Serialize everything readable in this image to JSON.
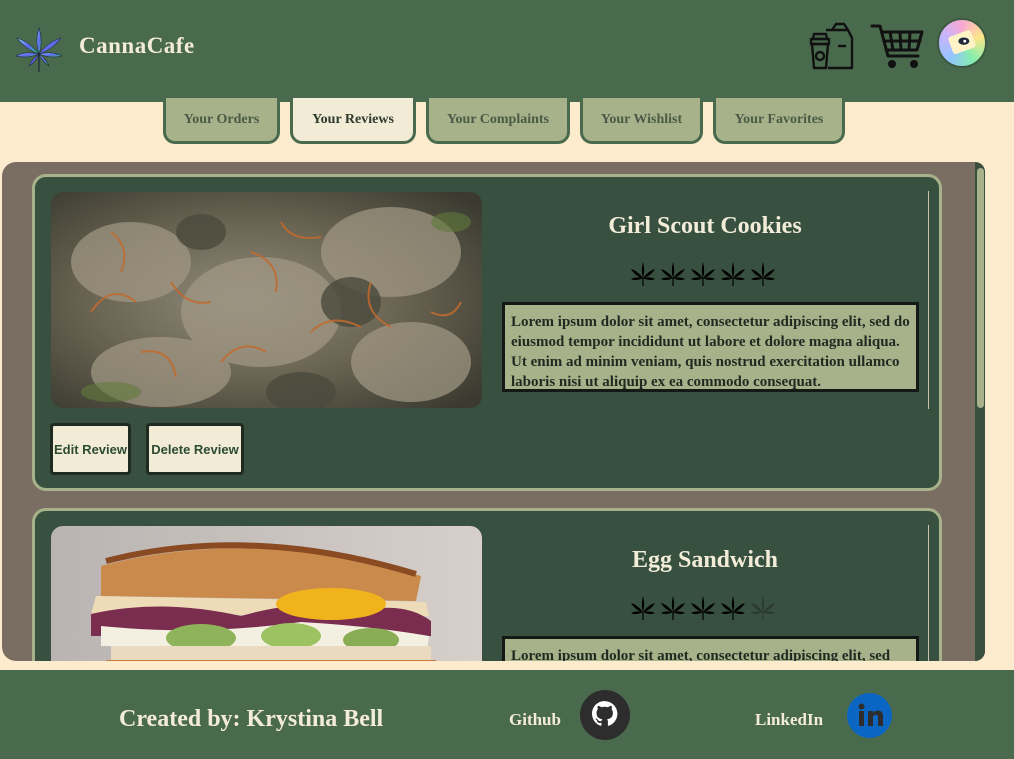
{
  "header": {
    "brand": "CannaCafe",
    "icons": [
      "cannabis-logo-icon",
      "coffee-bag-icon",
      "shopping-cart-icon",
      "avatar"
    ]
  },
  "tabs": [
    {
      "label": "Your Orders",
      "active": false
    },
    {
      "label": "Your Reviews",
      "active": true
    },
    {
      "label": "Your Complaints",
      "active": false
    },
    {
      "label": "Your Wishlist",
      "active": false
    },
    {
      "label": "Your Favorites",
      "active": false
    }
  ],
  "reviews": [
    {
      "title": "Girl Scout Cookies",
      "rating": 5,
      "max_rating": 5,
      "text": "Lorem ipsum dolor sit amet, consectetur adipiscing elit, sed do eiusmod tempor incididunt ut labore et dolore magna aliqua. Ut enim ad minim veniam, quis nostrud exercitation ullamco laboris nisi ut aliquip ex ea commodo consequat.",
      "edit_label": "Edit Review",
      "delete_label": "Delete Review"
    },
    {
      "title": "Egg Sandwich",
      "rating": 4,
      "max_rating": 5,
      "text": "Lorem ipsum dolor sit amet, consectetur adipiscing elit, sed"
    }
  ],
  "footer": {
    "credit": "Created by: Krystina Bell",
    "github_label": "Github",
    "linkedin_label": "LinkedIn"
  },
  "colors": {
    "header_bg": "#4a6a4e",
    "page_bg": "#fdebcd",
    "card_bg": "#37503f",
    "accent": "#a7b28b",
    "linkedin_blue": "#0a66c2"
  }
}
